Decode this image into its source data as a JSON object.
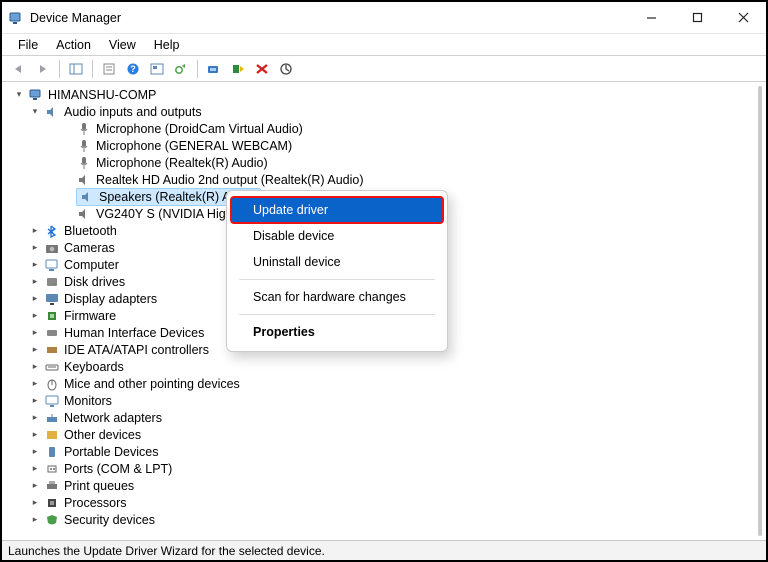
{
  "window": {
    "title": "Device Manager"
  },
  "menu": {
    "file": "File",
    "action": "Action",
    "view": "View",
    "help": "Help"
  },
  "tree": {
    "root": "HIMANSHU-COMP",
    "audio": {
      "label": "Audio inputs and outputs",
      "children": {
        "mic_droid": "Microphone (DroidCam Virtual Audio)",
        "mic_webcam": "Microphone (GENERAL WEBCAM)",
        "mic_realtek": "Microphone (Realtek(R) Audio)",
        "realtek_2nd": "Realtek HD Audio 2nd output (Realtek(R) Audio)",
        "speakers": "Speakers (Realtek(R) Audio)",
        "vg240y": "VG240Y S (NVIDIA High D"
      }
    },
    "categories": {
      "bluetooth": "Bluetooth",
      "cameras": "Cameras",
      "computer": "Computer",
      "disk": "Disk drives",
      "display": "Display adapters",
      "firmware": "Firmware",
      "hid": "Human Interface Devices",
      "ide": "IDE ATA/ATAPI controllers",
      "keyboards": "Keyboards",
      "mice": "Mice and other pointing devices",
      "monitors": "Monitors",
      "network": "Network adapters",
      "other": "Other devices",
      "portable": "Portable Devices",
      "ports": "Ports (COM & LPT)",
      "print": "Print queues",
      "processors": "Processors",
      "security": "Security devices"
    }
  },
  "context_menu": {
    "update": "Update driver",
    "disable": "Disable device",
    "uninstall": "Uninstall device",
    "scan": "Scan for hardware changes",
    "properties": "Properties"
  },
  "statusbar": {
    "text": "Launches the Update Driver Wizard for the selected device."
  }
}
